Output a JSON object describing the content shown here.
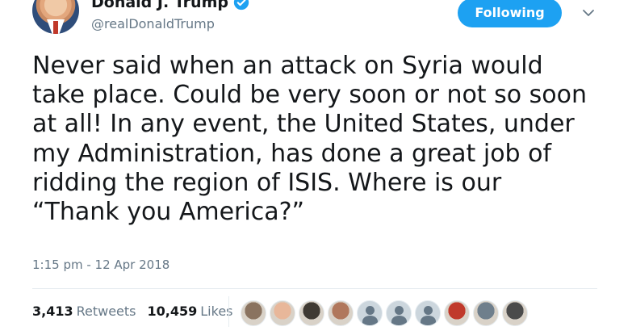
{
  "user": {
    "display_name": "Donald J. Trump",
    "handle": "@realDonaldTrump",
    "verified": true,
    "avatar": "profile-photo"
  },
  "follow_button": {
    "label": "Following"
  },
  "menu": {
    "icon": "chevron-down-icon"
  },
  "tweet": {
    "text": "Never said when an attack on Syria would\ntake place. Could be very soon or not so soon\nat all! In any event, the United States, under\nmy Administration, has done a great job of\nridding the region of ISIS. Where is our\n“Thank you America?”",
    "timestamp": "1:15 pm - 12 Apr 2018"
  },
  "stats": {
    "retweets": {
      "count": "3,413",
      "label": "Retweets"
    },
    "likes": {
      "count": "10,459",
      "label": "Likes"
    }
  },
  "likers": [
    {
      "kind": "photo",
      "color": "#8a7360"
    },
    {
      "kind": "photo",
      "color": "#e8b79a"
    },
    {
      "kind": "photo",
      "color": "#3f3a34"
    },
    {
      "kind": "photo",
      "color": "#b0775c"
    },
    {
      "kind": "default"
    },
    {
      "kind": "default"
    },
    {
      "kind": "default"
    },
    {
      "kind": "photo",
      "color": "#c0392b"
    },
    {
      "kind": "photo",
      "color": "#6f7f8c"
    },
    {
      "kind": "photo",
      "color": "#4b4b4b"
    }
  ],
  "colors": {
    "accent": "#1da1f2",
    "text": "#14171a",
    "muted": "#657786"
  }
}
